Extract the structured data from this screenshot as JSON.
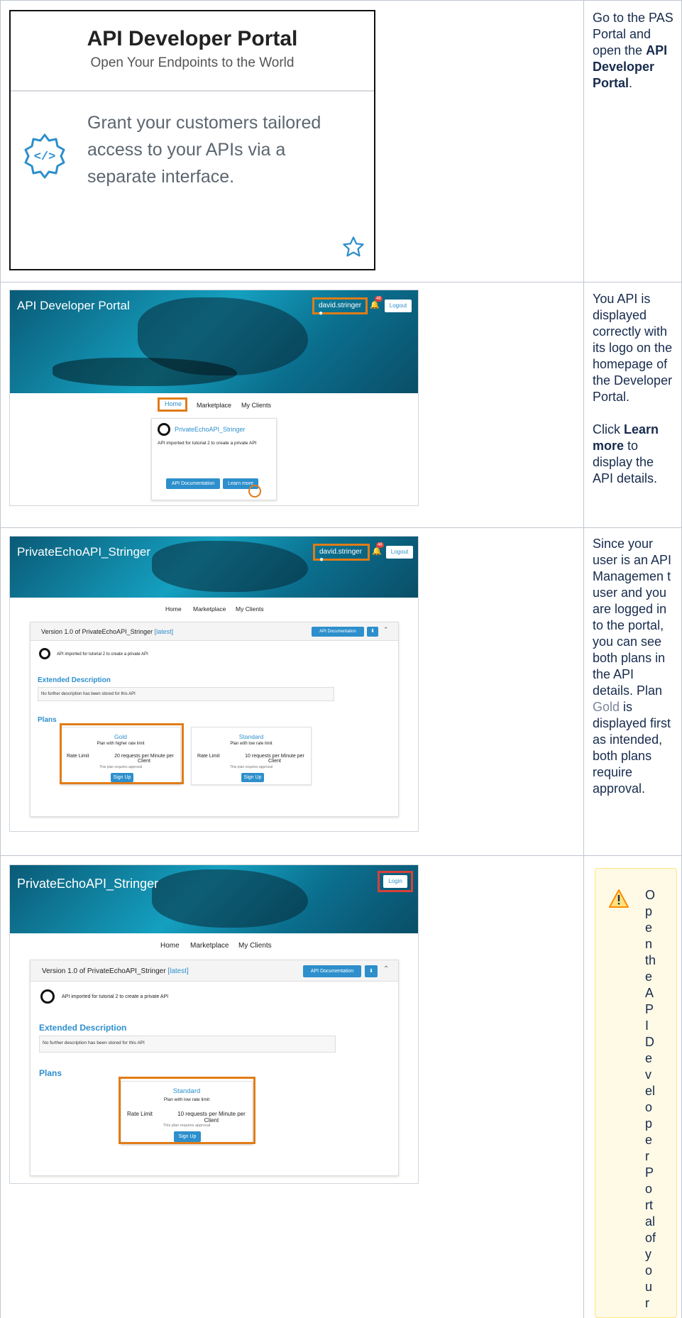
{
  "row1": {
    "card_title": "API Developer Portal",
    "card_subtitle": "Open Your Endpoints to the World",
    "card_description": "Grant your customers tailored access to your APIs via a separate interface.",
    "step_text_parts": [
      "Go to the PAS Portal and open the ",
      "API Developer Portal",
      "."
    ]
  },
  "row2": {
    "portal_title": "API Developer Portal",
    "user": "david.stringer",
    "notif_count": "48",
    "logout": "Logout",
    "nav": [
      "Home",
      "Marketplace",
      "My Clients"
    ],
    "api_name": "PrivateEchoAPI_Stringer",
    "api_desc": "API imported for tutorial 2 to create a private API",
    "btn_docs": "API Documentation",
    "btn_learn": "Learn more",
    "step_text_parts": [
      "You API is displayed correctly with its logo on the homepage of the Developer Portal.",
      "Click ",
      "Learn more",
      " to display the API details."
    ]
  },
  "row3": {
    "portal_title": "PrivateEchoAPI_Stringer",
    "user": "david.stringer",
    "notif_count": "48",
    "logout": "Logout",
    "nav": [
      "Home",
      "Marketplace",
      "My Clients"
    ],
    "version_prefix": "Version 1.0 of PrivateEchoAPI_Stringer",
    "version_tag": "[latest]",
    "btn_docs": "API Documentation",
    "api_desc": "API imported for tutorial 2 to create a private API",
    "ext_heading": "Extended Description",
    "ext_text": "No further description has been stored for this API",
    "plans_heading": "Plans",
    "plans": [
      {
        "name": "Gold",
        "desc": "Plan with higher rate limit",
        "limit_label": "Rate Limit",
        "limit_value": "20 requests per Minute per Client",
        "approval": "This plan requires approval",
        "signup": "Sign Up"
      },
      {
        "name": "Standard",
        "desc": "Plan with low rate limit",
        "limit_label": "Rate Limit",
        "limit_value": "10 requests per Minute per Client",
        "approval": "This plan requires approval",
        "signup": "Sign Up"
      }
    ],
    "step_text_parts": [
      "Since your user is an API Managemen t user and you are logged in to the portal, you can see both plans in the API details. Plan ",
      "Gold",
      " is displayed first as intended, both plans require approval."
    ]
  },
  "row4": {
    "portal_title": "PrivateEchoAPI_Stringer",
    "login": "Login",
    "nav": [
      "Home",
      "Marketplace",
      "My Clients"
    ],
    "version_prefix": "Version 1.0 of PrivateEchoAPI_Stringer",
    "version_tag": "[latest]",
    "btn_docs": "API Documentation",
    "api_desc": "API imported for tutorial 2 to create a private API",
    "ext_heading": "Extended Description",
    "ext_text": "No further description has been stored for this API",
    "plans_heading": "Plans",
    "plan": {
      "name": "Standard",
      "desc": "Plan with low rate limit",
      "limit_label": "Rate Limit",
      "limit_value": "10 requests per Minute per Client",
      "approval": "This plan requires approval",
      "signup": "Sign Up"
    },
    "warning_chars": [
      "O",
      "p",
      "e",
      "n",
      "th",
      "e",
      "A",
      "P",
      "I",
      "D",
      "e",
      "v",
      "el",
      "o",
      "p",
      "e",
      "r",
      "P",
      "o",
      "rt",
      "al",
      "of",
      "y",
      "o",
      "u",
      "r"
    ]
  },
  "colors": {
    "accent": "#2d8fcc",
    "highlight": "#e07c18",
    "login_highlight": "#d9403a",
    "border": "#c1c7d0",
    "warning_bg": "#fffae6"
  }
}
